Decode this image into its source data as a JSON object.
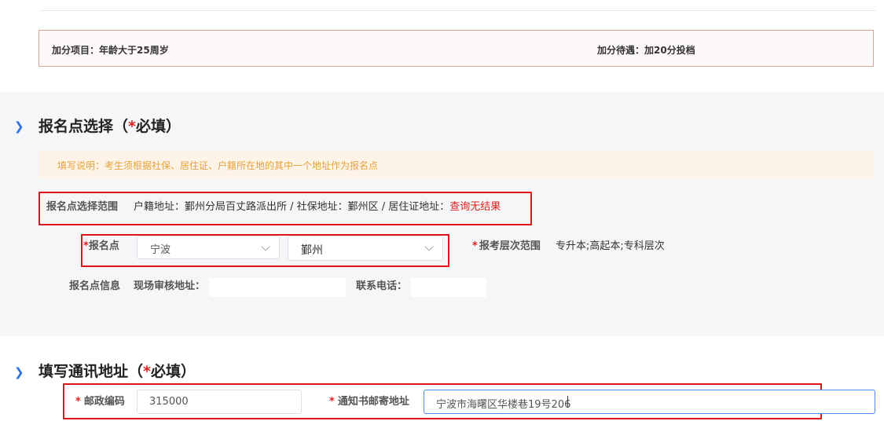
{
  "bonus": {
    "item_label": "加分项目：",
    "item_value": "年龄大于25周岁",
    "treatment_label": "加分待遇：",
    "treatment_value": "加20分投档"
  },
  "registration": {
    "title_prefix": "报名点选择（",
    "title_required_mark": "*",
    "title_required_text": "必填）",
    "notice": "填写说明：考生须根据社保、居住证、户籍所在地的其中一个地址作为报名点",
    "range_label": "报名点选择范围",
    "range_text": "户籍地址：鄞州分局百丈路派出所 / 社保地址：鄞州区 / 居住证地址：",
    "range_no_result": "查询无结果",
    "site_required_mark": "*",
    "site_label": "报名点",
    "site_city": "宁波",
    "site_district": "鄞州",
    "level_required_mark": "*",
    "level_label": "报考层次范围",
    "level_value": "专升本;高起本;专科层次",
    "info_label": "报名点信息",
    "audit_address_label": "现场审核地址：",
    "phone_label": "联系电话："
  },
  "address": {
    "title_prefix": "填写通讯地址（",
    "title_required_mark": "*",
    "title_required_text": "必填）",
    "postcode_required_mark": "*",
    "postcode_label": "邮政编码",
    "postcode_value": "315000",
    "mail_required_mark": "*",
    "mail_label": "通知书邮寄地址",
    "mail_value": "宁波市海曙区华楼巷19号206"
  },
  "colors": {
    "accent": "#2f6fe4",
    "required": "#e02020",
    "notice_text": "#e6a23c",
    "highlight_box": "#e0131a"
  }
}
